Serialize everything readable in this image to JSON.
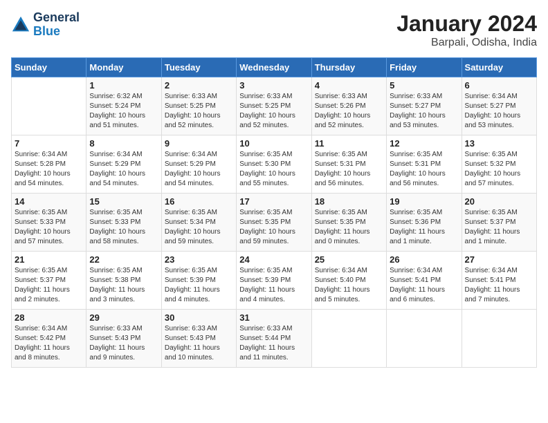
{
  "header": {
    "logo_line1": "General",
    "logo_line2": "Blue",
    "title": "January 2024",
    "subtitle": "Barpali, Odisha, India"
  },
  "columns": [
    "Sunday",
    "Monday",
    "Tuesday",
    "Wednesday",
    "Thursday",
    "Friday",
    "Saturday"
  ],
  "weeks": [
    [
      {
        "day": "",
        "text": ""
      },
      {
        "day": "1",
        "text": "Sunrise: 6:32 AM\nSunset: 5:24 PM\nDaylight: 10 hours\nand 51 minutes."
      },
      {
        "day": "2",
        "text": "Sunrise: 6:33 AM\nSunset: 5:25 PM\nDaylight: 10 hours\nand 52 minutes."
      },
      {
        "day": "3",
        "text": "Sunrise: 6:33 AM\nSunset: 5:25 PM\nDaylight: 10 hours\nand 52 minutes."
      },
      {
        "day": "4",
        "text": "Sunrise: 6:33 AM\nSunset: 5:26 PM\nDaylight: 10 hours\nand 52 minutes."
      },
      {
        "day": "5",
        "text": "Sunrise: 6:33 AM\nSunset: 5:27 PM\nDaylight: 10 hours\nand 53 minutes."
      },
      {
        "day": "6",
        "text": "Sunrise: 6:34 AM\nSunset: 5:27 PM\nDaylight: 10 hours\nand 53 minutes."
      }
    ],
    [
      {
        "day": "7",
        "text": "Sunrise: 6:34 AM\nSunset: 5:28 PM\nDaylight: 10 hours\nand 54 minutes."
      },
      {
        "day": "8",
        "text": "Sunrise: 6:34 AM\nSunset: 5:29 PM\nDaylight: 10 hours\nand 54 minutes."
      },
      {
        "day": "9",
        "text": "Sunrise: 6:34 AM\nSunset: 5:29 PM\nDaylight: 10 hours\nand 54 minutes."
      },
      {
        "day": "10",
        "text": "Sunrise: 6:35 AM\nSunset: 5:30 PM\nDaylight: 10 hours\nand 55 minutes."
      },
      {
        "day": "11",
        "text": "Sunrise: 6:35 AM\nSunset: 5:31 PM\nDaylight: 10 hours\nand 56 minutes."
      },
      {
        "day": "12",
        "text": "Sunrise: 6:35 AM\nSunset: 5:31 PM\nDaylight: 10 hours\nand 56 minutes."
      },
      {
        "day": "13",
        "text": "Sunrise: 6:35 AM\nSunset: 5:32 PM\nDaylight: 10 hours\nand 57 minutes."
      }
    ],
    [
      {
        "day": "14",
        "text": "Sunrise: 6:35 AM\nSunset: 5:33 PM\nDaylight: 10 hours\nand 57 minutes."
      },
      {
        "day": "15",
        "text": "Sunrise: 6:35 AM\nSunset: 5:33 PM\nDaylight: 10 hours\nand 58 minutes."
      },
      {
        "day": "16",
        "text": "Sunrise: 6:35 AM\nSunset: 5:34 PM\nDaylight: 10 hours\nand 59 minutes."
      },
      {
        "day": "17",
        "text": "Sunrise: 6:35 AM\nSunset: 5:35 PM\nDaylight: 10 hours\nand 59 minutes."
      },
      {
        "day": "18",
        "text": "Sunrise: 6:35 AM\nSunset: 5:35 PM\nDaylight: 11 hours\nand 0 minutes."
      },
      {
        "day": "19",
        "text": "Sunrise: 6:35 AM\nSunset: 5:36 PM\nDaylight: 11 hours\nand 1 minute."
      },
      {
        "day": "20",
        "text": "Sunrise: 6:35 AM\nSunset: 5:37 PM\nDaylight: 11 hours\nand 1 minute."
      }
    ],
    [
      {
        "day": "21",
        "text": "Sunrise: 6:35 AM\nSunset: 5:37 PM\nDaylight: 11 hours\nand 2 minutes."
      },
      {
        "day": "22",
        "text": "Sunrise: 6:35 AM\nSunset: 5:38 PM\nDaylight: 11 hours\nand 3 minutes."
      },
      {
        "day": "23",
        "text": "Sunrise: 6:35 AM\nSunset: 5:39 PM\nDaylight: 11 hours\nand 4 minutes."
      },
      {
        "day": "24",
        "text": "Sunrise: 6:35 AM\nSunset: 5:39 PM\nDaylight: 11 hours\nand 4 minutes."
      },
      {
        "day": "25",
        "text": "Sunrise: 6:34 AM\nSunset: 5:40 PM\nDaylight: 11 hours\nand 5 minutes."
      },
      {
        "day": "26",
        "text": "Sunrise: 6:34 AM\nSunset: 5:41 PM\nDaylight: 11 hours\nand 6 minutes."
      },
      {
        "day": "27",
        "text": "Sunrise: 6:34 AM\nSunset: 5:41 PM\nDaylight: 11 hours\nand 7 minutes."
      }
    ],
    [
      {
        "day": "28",
        "text": "Sunrise: 6:34 AM\nSunset: 5:42 PM\nDaylight: 11 hours\nand 8 minutes."
      },
      {
        "day": "29",
        "text": "Sunrise: 6:33 AM\nSunset: 5:43 PM\nDaylight: 11 hours\nand 9 minutes."
      },
      {
        "day": "30",
        "text": "Sunrise: 6:33 AM\nSunset: 5:43 PM\nDaylight: 11 hours\nand 10 minutes."
      },
      {
        "day": "31",
        "text": "Sunrise: 6:33 AM\nSunset: 5:44 PM\nDaylight: 11 hours\nand 11 minutes."
      },
      {
        "day": "",
        "text": ""
      },
      {
        "day": "",
        "text": ""
      },
      {
        "day": "",
        "text": ""
      }
    ]
  ]
}
